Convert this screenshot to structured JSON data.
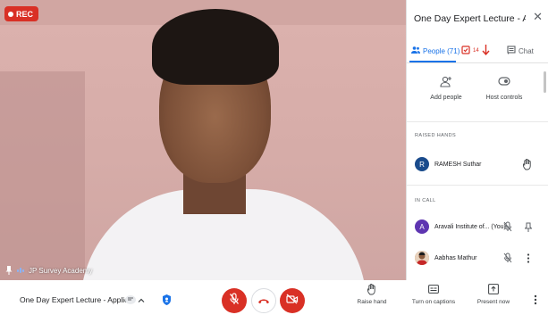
{
  "video": {
    "rec_label": "REC",
    "speaker_name": "JP Survey Academy"
  },
  "panel": {
    "title": "One Day Expert Lecture - Applicati...",
    "tabs": {
      "people_label": "People (71)",
      "count_label": "14",
      "chat_label": "Chat"
    },
    "actions": {
      "add_people": "Add people",
      "host_controls": "Host controls"
    },
    "raised_hands_label": "RAISED HANDS",
    "raised_hands": [
      {
        "initial": "R",
        "name": "RAMESH Suthar",
        "avatar_color": "#1a4b8c"
      }
    ],
    "in_call_label": "IN CALL",
    "in_call": [
      {
        "initial": "A",
        "name": "Aravali Institute of... (You)",
        "avatar_color": "#5e35b1"
      },
      {
        "initial": "",
        "name": "Aabhas Mathur",
        "avatar_color": "#c0703a"
      }
    ]
  },
  "bottombar": {
    "meeting_title": "One Day Expert Lecture - Applic...",
    "raise_hand": "Raise hand",
    "captions": "Turn on captions",
    "present": "Present now"
  },
  "colors": {
    "accent": "#1a73e8",
    "danger": "#d93025"
  }
}
